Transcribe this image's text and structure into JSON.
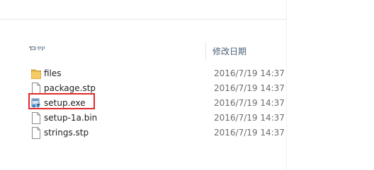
{
  "header": {
    "name_column_label": "名称",
    "date_column_label": "修改日期"
  },
  "files": [
    {
      "name": "files",
      "modified": "2016/7/19 14:37",
      "icon": "folder-icon"
    },
    {
      "name": "package.stp",
      "modified": "2016/7/19 14:37",
      "icon": "document-icon"
    },
    {
      "name": "setup.exe",
      "modified": "2016/7/19 14:37",
      "icon": "installer-icon"
    },
    {
      "name": "setup-1a.bin",
      "modified": "2016/7/19 14:37",
      "icon": "document-icon"
    },
    {
      "name": "strings.stp",
      "modified": "2016/7/19 14:37",
      "icon": "document-icon"
    }
  ],
  "colors": {
    "highlight": "#e0282b",
    "folder": "#e8b84a",
    "header_text": "#4c607a"
  }
}
